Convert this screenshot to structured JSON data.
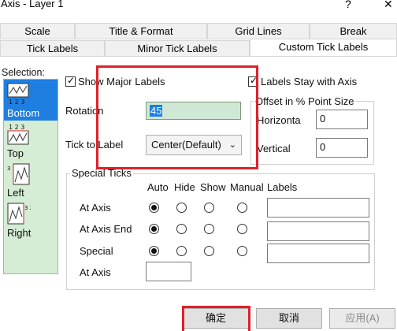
{
  "window": {
    "title": "Axis - Layer 1",
    "help_glyph": "?",
    "close_glyph": "✕"
  },
  "tabs_row1": [
    "Scale",
    "Title & Format",
    "Grid Lines",
    "Break"
  ],
  "tabs_row2": [
    "Tick Labels",
    "Minor Tick Labels",
    "Custom Tick Labels"
  ],
  "active_tab": "Custom Tick Labels",
  "selection": {
    "label": "Selection:",
    "items": [
      {
        "caption": "Bottom",
        "icon": "bottom-axis-icon",
        "selected": true,
        "glyph_text": "1 2 3"
      },
      {
        "caption": "Top",
        "icon": "top-axis-icon",
        "selected": false,
        "glyph_text": "1 2 3"
      },
      {
        "caption": "Left",
        "icon": "left-axis-icon",
        "selected": false,
        "glyph_text": "3 2 1"
      },
      {
        "caption": "Right",
        "icon": "right-axis-icon",
        "selected": false,
        "glyph_text": "3 2 1"
      }
    ]
  },
  "show_major_labels": {
    "label": "Show Major Labels",
    "checked": true
  },
  "rotation": {
    "label": "Rotation",
    "value": "45"
  },
  "tick_to_label": {
    "label": "Tick to Label",
    "value": "Center(Default)"
  },
  "labels_stay_with_axis": {
    "label": "Labels Stay with Axis",
    "checked": true
  },
  "offset": {
    "title": "Offset in % Point Size",
    "horizontal": {
      "label": "Horizonta",
      "value": "0"
    },
    "vertical": {
      "label": "Vertical",
      "value": "0"
    }
  },
  "special_ticks": {
    "title": "Special Ticks",
    "columns": [
      "Auto",
      "Hide",
      "Show",
      "Manual",
      "Labels"
    ],
    "rows": [
      {
        "label": "At Axis",
        "selected": "Auto",
        "labels_value": ""
      },
      {
        "label": "At Axis End",
        "selected": "Auto",
        "labels_value": ""
      },
      {
        "label": "Special",
        "selected": "Auto",
        "labels_value": ""
      }
    ],
    "at_axis_field": {
      "label": "At Axis",
      "value": ""
    }
  },
  "buttons": {
    "ok": "确定",
    "cancel": "取消",
    "apply": "应用(A)"
  },
  "colors": {
    "highlight": "#e0202a",
    "selection_bg": "#d5ecd5",
    "selected_item": "#1e7fe0",
    "rotation_field": "#cfe8d6"
  }
}
